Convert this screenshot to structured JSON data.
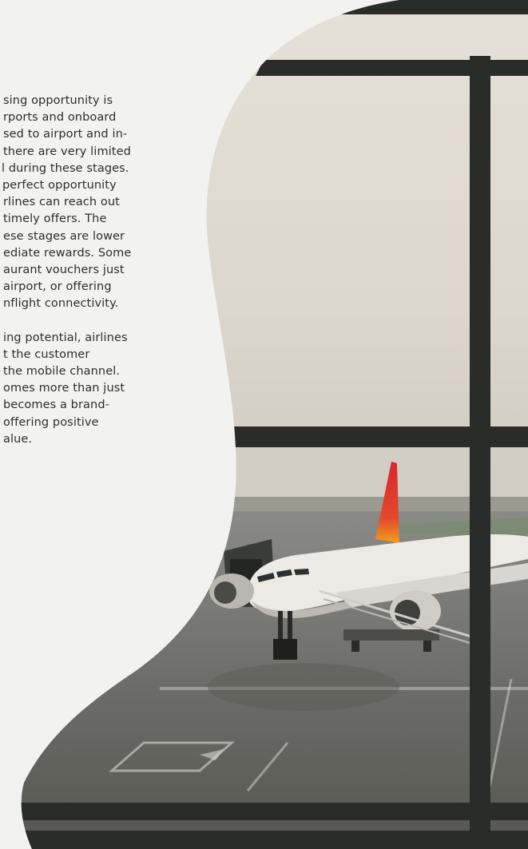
{
  "article": {
    "paragraphs": [
      [
        "sing opportunity is",
        "rports and onboard",
        "sed to airport and in-",
        "there are very limited",
        "l during these stages.",
        " perfect opportunity",
        "rlines can reach out",
        " timely offers. The",
        "ese stages are lower",
        "ediate rewards. Some",
        "aurant vouchers just",
        "airport, or offering",
        "nflight connectivity."
      ],
      [
        "ing potential, airlines",
        "t the customer",
        "the mobile channel.",
        "omes more than just",
        " becomes a brand-",
        " offering positive",
        "alue."
      ]
    ]
  },
  "image": {
    "subject": "airplane-at-airport-gate-through-window"
  },
  "colors": {
    "page_background": "#f2f3f1",
    "text": "#2d2d2d",
    "window_frame": "#2a2c2a",
    "sky": "#ddd8cf",
    "tarmac": "#6f706c",
    "tail_red": "#d9262b"
  }
}
